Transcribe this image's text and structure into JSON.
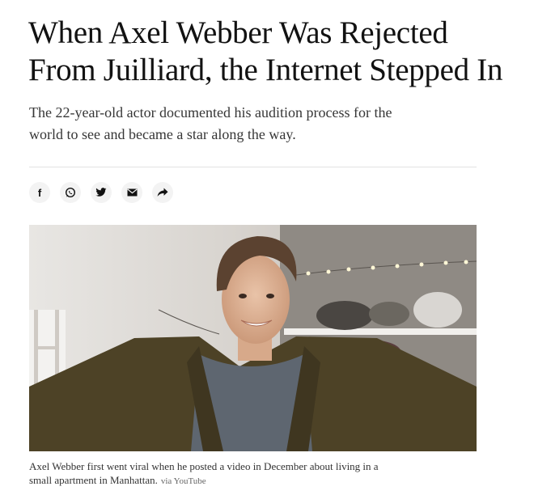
{
  "article": {
    "headline_line1": "When Axel Webber Was Rejected",
    "headline_line2": "From Juilliard, the Internet Stepped In",
    "summary_line1": "The 22-year-old actor documented his audition process for the",
    "summary_line2": "world to see and became a star along the way."
  },
  "share": {
    "buttons": [
      {
        "icon": "facebook-icon"
      },
      {
        "icon": "whatsapp-icon"
      },
      {
        "icon": "twitter-icon"
      },
      {
        "icon": "email-icon"
      },
      {
        "icon": "share-arrow-icon"
      }
    ],
    "facebook_glyph": "f"
  },
  "image": {
    "caption_line1": "Axel Webber first went viral when he posted a video in December about living in a",
    "caption_line2": "small apartment in Manhattan.",
    "credit": "via YouTube"
  },
  "colors": {
    "text": "#121212",
    "summary": "#363636",
    "divider": "#e2e2e2",
    "share_bg": "#f3f3f3"
  }
}
